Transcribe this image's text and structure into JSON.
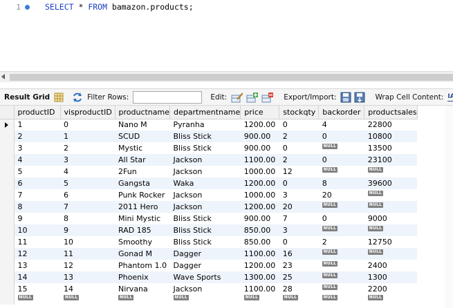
{
  "editor": {
    "line_number": "1",
    "query_keyword_1": "SELECT",
    "query_star": " * ",
    "query_keyword_2": "FROM",
    "query_rest": " bamazon.products;"
  },
  "toolbar": {
    "result_grid_label": "Result Grid",
    "filter_rows_label": "Filter Rows:",
    "filter_rows_value": "",
    "edit_label": "Edit:",
    "export_import_label": "Export/Import:",
    "wrap_cell_label": "Wrap Cell Content:",
    "wrap_icon_text": "IA"
  },
  "grid": {
    "null_text": "NULL",
    "columns": [
      "productID",
      "visproductID",
      "productname",
      "departmentname",
      "price",
      "stockqty",
      "backorder",
      "productsales"
    ],
    "rows": [
      [
        "1",
        "0",
        "Nano M",
        "Pyranha",
        "1200.00",
        "0",
        "4",
        "22800"
      ],
      [
        "2",
        "1",
        "SCUD",
        "Bliss Stick",
        "900.00",
        "2",
        "0",
        "10800"
      ],
      [
        "3",
        "2",
        "Mystic",
        "Bliss Stick",
        "900.00",
        "0",
        null,
        "13500"
      ],
      [
        "4",
        "3",
        "All Star",
        "Jackson",
        "1100.00",
        "2",
        "0",
        "23100"
      ],
      [
        "5",
        "4",
        "2Fun",
        "Jackson",
        "1000.00",
        "12",
        null,
        null
      ],
      [
        "6",
        "5",
        "Gangsta",
        "Waka",
        "1200.00",
        "0",
        "8",
        "39600"
      ],
      [
        "7",
        "6",
        "Punk Rocker",
        "Jackson",
        "1000.00",
        "3",
        "20",
        null
      ],
      [
        "8",
        "7",
        "2011 Hero",
        "Jackson",
        "1200.00",
        "20",
        null,
        null
      ],
      [
        "9",
        "8",
        "Mini Mystic",
        "Bliss Stick",
        "900.00",
        "7",
        "0",
        "9000"
      ],
      [
        "10",
        "9",
        "RAD 185",
        "Bliss Stick",
        "850.00",
        "3",
        null,
        null
      ],
      [
        "11",
        "10",
        "Smoothy",
        "Bliss Stick",
        "850.00",
        "0",
        "2",
        "12750"
      ],
      [
        "12",
        "11",
        "Gonad M",
        "Dagger",
        "1100.00",
        "16",
        null,
        null
      ],
      [
        "13",
        "12",
        "Phantom 1.0",
        "Dagger",
        "1200.00",
        "23",
        null,
        "2400"
      ],
      [
        "14",
        "13",
        "Phoenix",
        "Wave Sports",
        "1300.00",
        "25",
        null,
        "1300"
      ],
      [
        "15",
        "14",
        "Nirvana",
        "Jackson",
        "1100.00",
        "28",
        null,
        "2200"
      ]
    ],
    "new_row": [
      null,
      null,
      null,
      null,
      null,
      null,
      null,
      null
    ]
  }
}
